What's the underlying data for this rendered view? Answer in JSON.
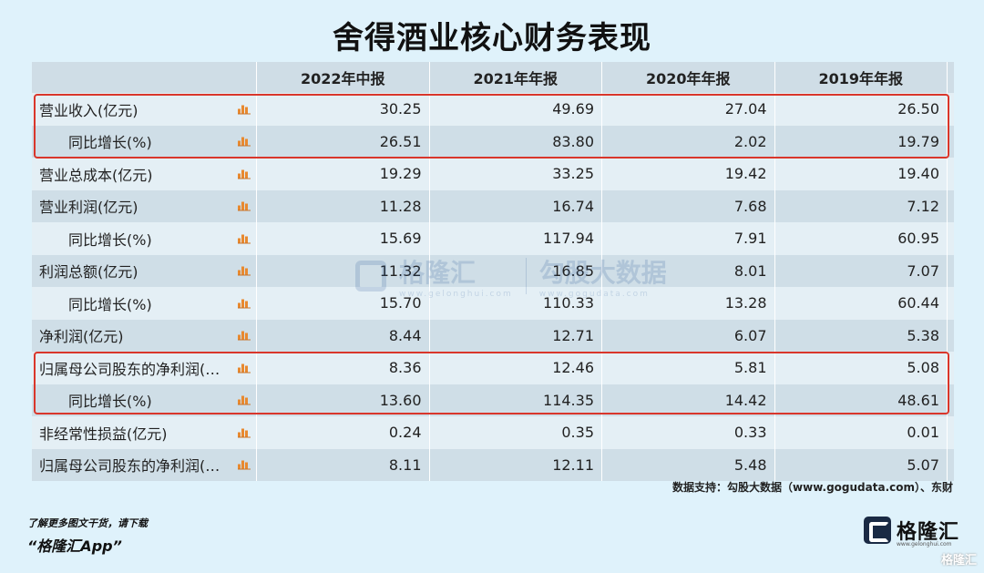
{
  "title": "舍得酒业核心财务表现",
  "table": {
    "headers": [
      "",
      "2022年中报",
      "2021年年报",
      "2020年年报",
      "2019年年报"
    ],
    "rows": [
      {
        "label": "营业收入(亿元)",
        "indent": false,
        "values": [
          "30.25",
          "49.69",
          "27.04",
          "26.50"
        ]
      },
      {
        "label": "同比增长(%)",
        "indent": true,
        "values": [
          "26.51",
          "83.80",
          "2.02",
          "19.79"
        ]
      },
      {
        "label": "营业总成本(亿元)",
        "indent": false,
        "values": [
          "19.29",
          "33.25",
          "19.42",
          "19.40"
        ]
      },
      {
        "label": "营业利润(亿元)",
        "indent": false,
        "values": [
          "11.28",
          "16.74",
          "7.68",
          "7.12"
        ]
      },
      {
        "label": "同比增长(%)",
        "indent": true,
        "values": [
          "15.69",
          "117.94",
          "7.91",
          "60.95"
        ]
      },
      {
        "label": "利润总额(亿元)",
        "indent": false,
        "values": [
          "11.32",
          "16.85",
          "8.01",
          "7.07"
        ]
      },
      {
        "label": "同比增长(%)",
        "indent": true,
        "values": [
          "15.70",
          "110.33",
          "13.28",
          "60.44"
        ]
      },
      {
        "label": "净利润(亿元)",
        "indent": false,
        "values": [
          "8.44",
          "12.71",
          "6.07",
          "5.38"
        ]
      },
      {
        "label": "归属母公司股东的净利润(…",
        "indent": false,
        "values": [
          "8.36",
          "12.46",
          "5.81",
          "5.08"
        ]
      },
      {
        "label": "同比增长(%)",
        "indent": true,
        "values": [
          "13.60",
          "114.35",
          "14.42",
          "48.61"
        ]
      },
      {
        "label": "非经常性损益(亿元)",
        "indent": false,
        "values": [
          "0.24",
          "0.35",
          "0.33",
          "0.01"
        ]
      },
      {
        "label": "归属母公司股东的净利润(…",
        "indent": false,
        "values": [
          "8.11",
          "12.11",
          "5.48",
          "5.07"
        ]
      }
    ]
  },
  "source": "数据支持：勾股大数据（www.gogudata.com）、东财",
  "promo": {
    "line1": "了解更多图文干货，请下载",
    "line2": "“格隆汇App”"
  },
  "watermark": {
    "brand": "格隆汇",
    "brand_sub": "www.gelonghui.com",
    "partner": "勾股大数据",
    "partner_sub": "www.gogudata.com"
  },
  "brand": {
    "name": "格隆汇",
    "sub": "www.gelonghui.com"
  },
  "corner_mark": "格隆汇",
  "colors": {
    "background": "#dff2fb",
    "highlight": "#d9362b",
    "icon": "#e8892f"
  }
}
